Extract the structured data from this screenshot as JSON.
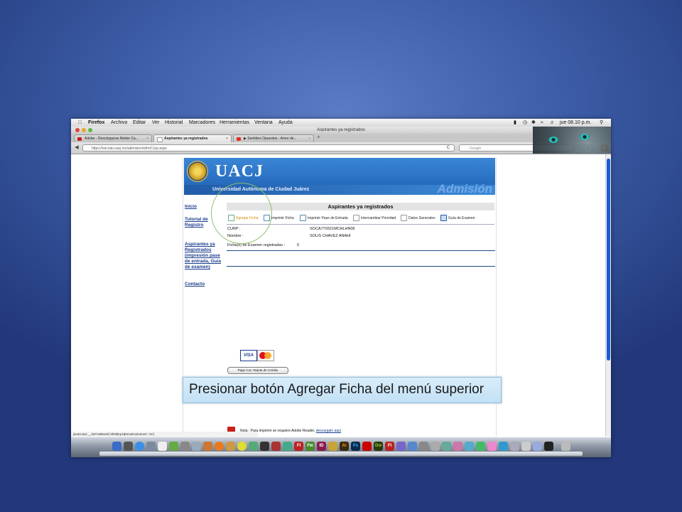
{
  "menubar": {
    "app": "Firefox",
    "items": [
      "Archivo",
      "Editar",
      "Ver",
      "Historial",
      "Marcadores",
      "Herramientas",
      "Ventana",
      "Ayuda"
    ],
    "clock": "jue 08.10 p.m."
  },
  "window": {
    "title": "Aspirantes ya registrados"
  },
  "tabs": [
    {
      "label": "Adobe - Descárguese Adobe Ca...",
      "close": "×"
    },
    {
      "label": "Aspirantes ya registrados",
      "close": "×"
    },
    {
      "label": "▶ Sentidos Opuestos - Amor de...",
      "close": "×"
    }
  ],
  "new_tab": "+",
  "navbar": {
    "url": "https://escolar.uacj.mx/admision/wfrmCurp.aspx",
    "search_placeholder": "Google",
    "back": "◀",
    "reload": "C"
  },
  "banner": {
    "logo_text": "UACJ",
    "university": "Universidad Autónoma de Ciudad Juárez",
    "section": "Admisión"
  },
  "sidebar": {
    "inicio": "Inicio",
    "tutorial": "Tutorial de Registro",
    "aspirantes": "Aspirantes ya Registrados (impresión pase de entrada, Guía de examen)",
    "contacto": "Contacto"
  },
  "main": {
    "header": "Aspirantes ya registrados",
    "toolbar": [
      "Agregar Ficha",
      "Imprimir Ficha",
      "Imprimir Pase de Entrada",
      "Intercambiar Prioridad",
      "Datos Generales",
      "Guía de Examen"
    ],
    "curp_label": "CURP :",
    "curp_value": "SOCA770321MCHLHN06",
    "nombre_label": "Nombre :",
    "nombre_value": "SOLIS CHAVEZ ANAHI",
    "fichas_label": "Ficha(s) de Examen registradas :",
    "fichas_value": "0"
  },
  "payment": {
    "visa": "VISA",
    "button": "Pago Con Tarjeta de Crédito"
  },
  "note": {
    "text": "Nota : Para imprimir se requiere Adobe Reader,",
    "link": "descargalo aqui"
  },
  "status_bar": "javascript:__doPostBack('ctl00$cp1$mnuExamenes','A5')",
  "dock_icons": [
    "Fl",
    "Fw",
    "ID",
    "Ai",
    "Ps",
    "Dw",
    "Fl"
  ],
  "callout": "Presionar botón Agregar Ficha del menú superior"
}
